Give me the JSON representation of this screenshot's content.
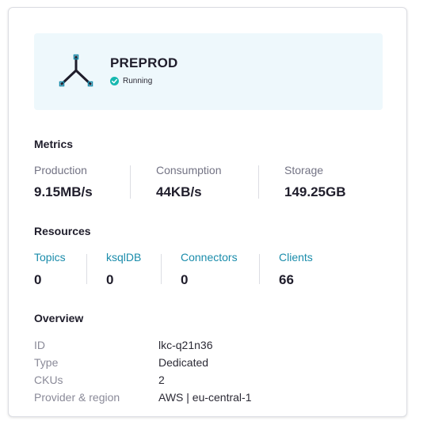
{
  "cluster": {
    "name": "PREPROD",
    "status": "Running",
    "icon": "cluster-topology-icon",
    "status_icon": "check-circle-icon",
    "status_color": "#17b8b0"
  },
  "metrics": {
    "title": "Metrics",
    "items": [
      {
        "label": "Production",
        "value": "9.15MB/s"
      },
      {
        "label": "Consumption",
        "value": "44KB/s"
      },
      {
        "label": "Storage",
        "value": "149.25GB"
      }
    ]
  },
  "resources": {
    "title": "Resources",
    "items": [
      {
        "label": "Topics",
        "value": "0"
      },
      {
        "label": "ksqlDB",
        "value": "0"
      },
      {
        "label": "Connectors",
        "value": "0"
      },
      {
        "label": "Clients",
        "value": "66"
      }
    ]
  },
  "overview": {
    "title": "Overview",
    "rows": [
      {
        "label": "ID",
        "value": "lkc-q21n36"
      },
      {
        "label": "Type",
        "value": "Dedicated"
      },
      {
        "label": "CKUs",
        "value": "2"
      },
      {
        "label": "Provider & region",
        "value": "AWS | eu-central-1"
      }
    ]
  },
  "colors": {
    "link": "#1a8cab",
    "header_bg": "#eef8fc",
    "icon_dark": "#1f1d2b",
    "icon_accent": "#1a8cab"
  }
}
